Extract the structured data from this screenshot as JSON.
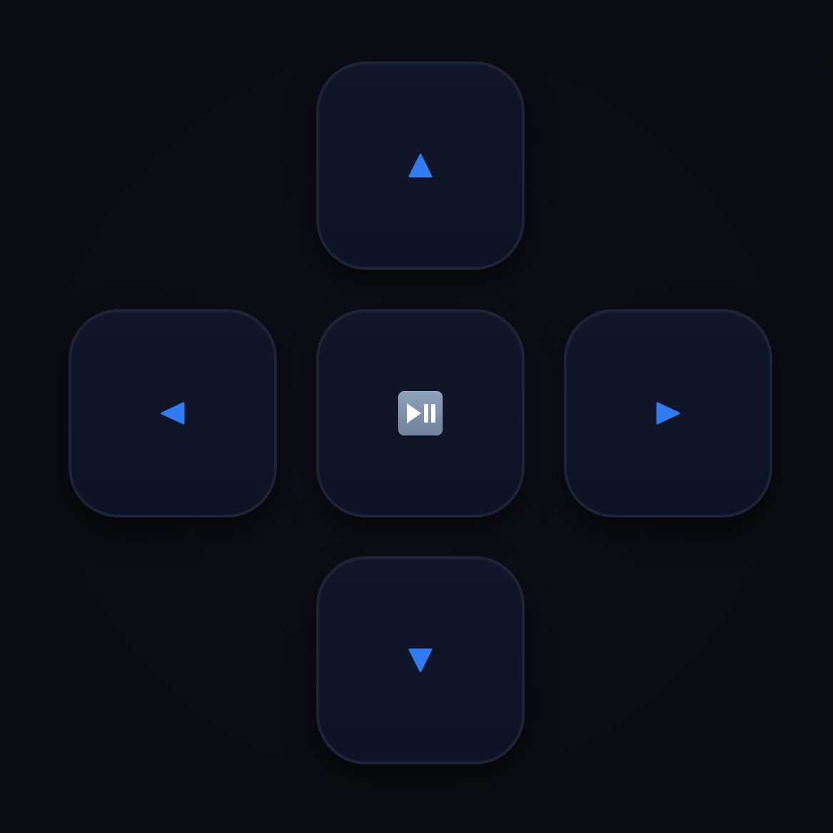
{
  "theme": {
    "accent": "#2f7bf0",
    "key_fill": "#111729",
    "key_border": "#1e2437",
    "background": "#0b0d13",
    "play_pause_fill": "#8394ad"
  },
  "dpad": {
    "up": {
      "icon": "arrow-up-icon"
    },
    "left": {
      "icon": "arrow-left-icon"
    },
    "center": {
      "icon": "play-pause-icon"
    },
    "right": {
      "icon": "arrow-right-icon"
    },
    "down": {
      "icon": "arrow-down-icon"
    }
  }
}
